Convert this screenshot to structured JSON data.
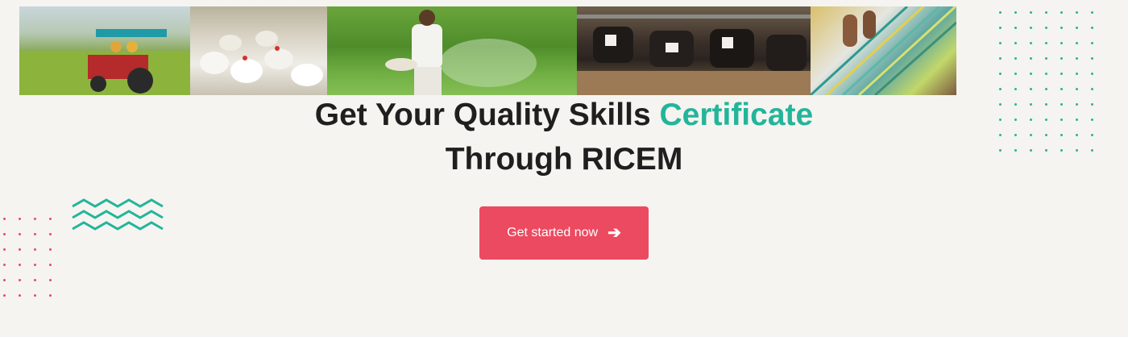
{
  "banner": {
    "photos": [
      {
        "name": "tractor"
      },
      {
        "name": "poultry"
      },
      {
        "name": "farmer"
      },
      {
        "name": "dairy"
      },
      {
        "name": "weaving"
      }
    ]
  },
  "hero": {
    "line1_prefix": "Get Your Quality Skills ",
    "line1_accent": "Certificate",
    "line2": "Through RICEM"
  },
  "cta": {
    "label": "Get started now",
    "icon": "arrow-right-icon",
    "arrow_glyph": "➔"
  },
  "colors": {
    "background": "#f5f4f0",
    "accent_teal": "#23b59a",
    "button": "#ec4a60",
    "heading": "#1f1f1f"
  }
}
